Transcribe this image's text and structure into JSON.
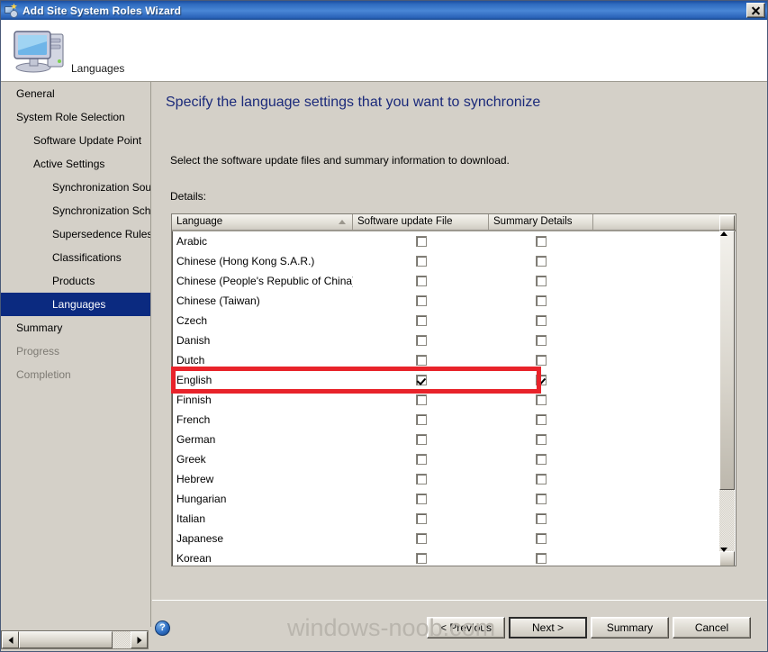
{
  "window": {
    "title": "Add Site System Roles Wizard",
    "title_icon": "wizard-icon",
    "close_label": "Close"
  },
  "header": {
    "page_name": "Languages",
    "icon": "computer-icon"
  },
  "sidebar": {
    "items": [
      {
        "label": "General",
        "level": 0,
        "state": "normal"
      },
      {
        "label": "System Role Selection",
        "level": 0,
        "state": "normal"
      },
      {
        "label": "Software Update Point",
        "level": 1,
        "state": "normal"
      },
      {
        "label": "Active Settings",
        "level": 1,
        "state": "normal"
      },
      {
        "label": "Synchronization Source",
        "level": 2,
        "state": "normal"
      },
      {
        "label": "Synchronization Schedule",
        "level": 2,
        "state": "normal"
      },
      {
        "label": "Supersedence Rules",
        "level": 2,
        "state": "normal"
      },
      {
        "label": "Classifications",
        "level": 2,
        "state": "normal"
      },
      {
        "label": "Products",
        "level": 2,
        "state": "normal"
      },
      {
        "label": "Languages",
        "level": 2,
        "state": "selected"
      },
      {
        "label": "Summary",
        "level": 0,
        "state": "normal"
      },
      {
        "label": "Progress",
        "level": 0,
        "state": "disabled"
      },
      {
        "label": "Completion",
        "level": 0,
        "state": "disabled"
      }
    ]
  },
  "main": {
    "heading": "Specify the language settings that you want to synchronize",
    "instruction": "Select the software update files and summary information to download.",
    "details_label": "Details:",
    "columns": [
      {
        "label": "Language",
        "sort": "ascending"
      },
      {
        "label": "Software update File",
        "sort": "none"
      },
      {
        "label": "Summary Details",
        "sort": "none"
      }
    ],
    "rows": [
      {
        "language": "Arabic",
        "software_update_file": false,
        "summary_details": false
      },
      {
        "language": "Chinese (Hong Kong S.A.R.)",
        "software_update_file": false,
        "summary_details": false
      },
      {
        "language": "Chinese (People's Republic of China)",
        "software_update_file": false,
        "summary_details": false
      },
      {
        "language": "Chinese (Taiwan)",
        "software_update_file": false,
        "summary_details": false
      },
      {
        "language": "Czech",
        "software_update_file": false,
        "summary_details": false
      },
      {
        "language": "Danish",
        "software_update_file": false,
        "summary_details": false
      },
      {
        "language": "Dutch",
        "software_update_file": false,
        "summary_details": false
      },
      {
        "language": "English",
        "software_update_file": true,
        "summary_details": true
      },
      {
        "language": "Finnish",
        "software_update_file": false,
        "summary_details": false
      },
      {
        "language": "French",
        "software_update_file": false,
        "summary_details": false
      },
      {
        "language": "German",
        "software_update_file": false,
        "summary_details": false
      },
      {
        "language": "Greek",
        "software_update_file": false,
        "summary_details": false
      },
      {
        "language": "Hebrew",
        "software_update_file": false,
        "summary_details": false
      },
      {
        "language": "Hungarian",
        "software_update_file": false,
        "summary_details": false
      },
      {
        "language": "Italian",
        "software_update_file": false,
        "summary_details": false
      },
      {
        "language": "Japanese",
        "software_update_file": false,
        "summary_details": false
      },
      {
        "language": "Korean",
        "software_update_file": false,
        "summary_details": false
      }
    ],
    "annotation": {
      "target_row": "English",
      "color": "#e8232a"
    }
  },
  "footer": {
    "help_glyph": "?",
    "buttons": [
      {
        "label": "< Previous",
        "default": false
      },
      {
        "label": "Next >",
        "default": true
      },
      {
        "label": "Summary",
        "default": false
      },
      {
        "label": "Cancel",
        "default": false
      }
    ]
  },
  "watermark": "windows-noob.com",
  "colors": {
    "titlebar_blue": "#2f6cc0",
    "dialog_face": "#d4d0c8",
    "heading_blue": "#1b2a7a",
    "selection_blue": "#0b2a80",
    "annotation_red": "#e8232a"
  }
}
